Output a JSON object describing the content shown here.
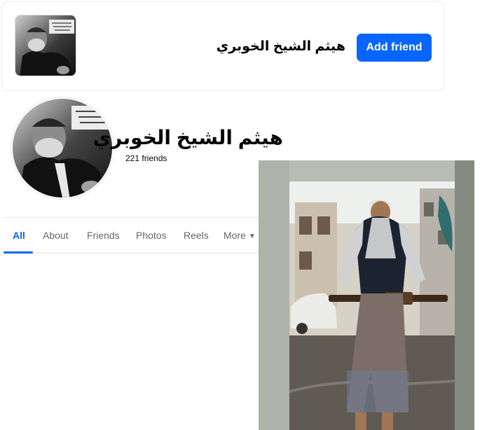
{
  "mini_card": {
    "name": "هيثم الشيخ الخوبري",
    "add_friend_label": "Add friend"
  },
  "profile": {
    "name": "هيثم الشيخ الخوبري",
    "friends": "221 friends"
  },
  "tabs": [
    {
      "label": "All",
      "active": true
    },
    {
      "label": "About"
    },
    {
      "label": "Friends"
    },
    {
      "label": "Photos"
    },
    {
      "label": "Reels"
    },
    {
      "label": "More"
    }
  ],
  "icons": {
    "more": "caret-down-icon"
  },
  "colors": {
    "accent": "#0866ff",
    "tab_text": "#65676b",
    "divider": "#e4e6eb"
  }
}
